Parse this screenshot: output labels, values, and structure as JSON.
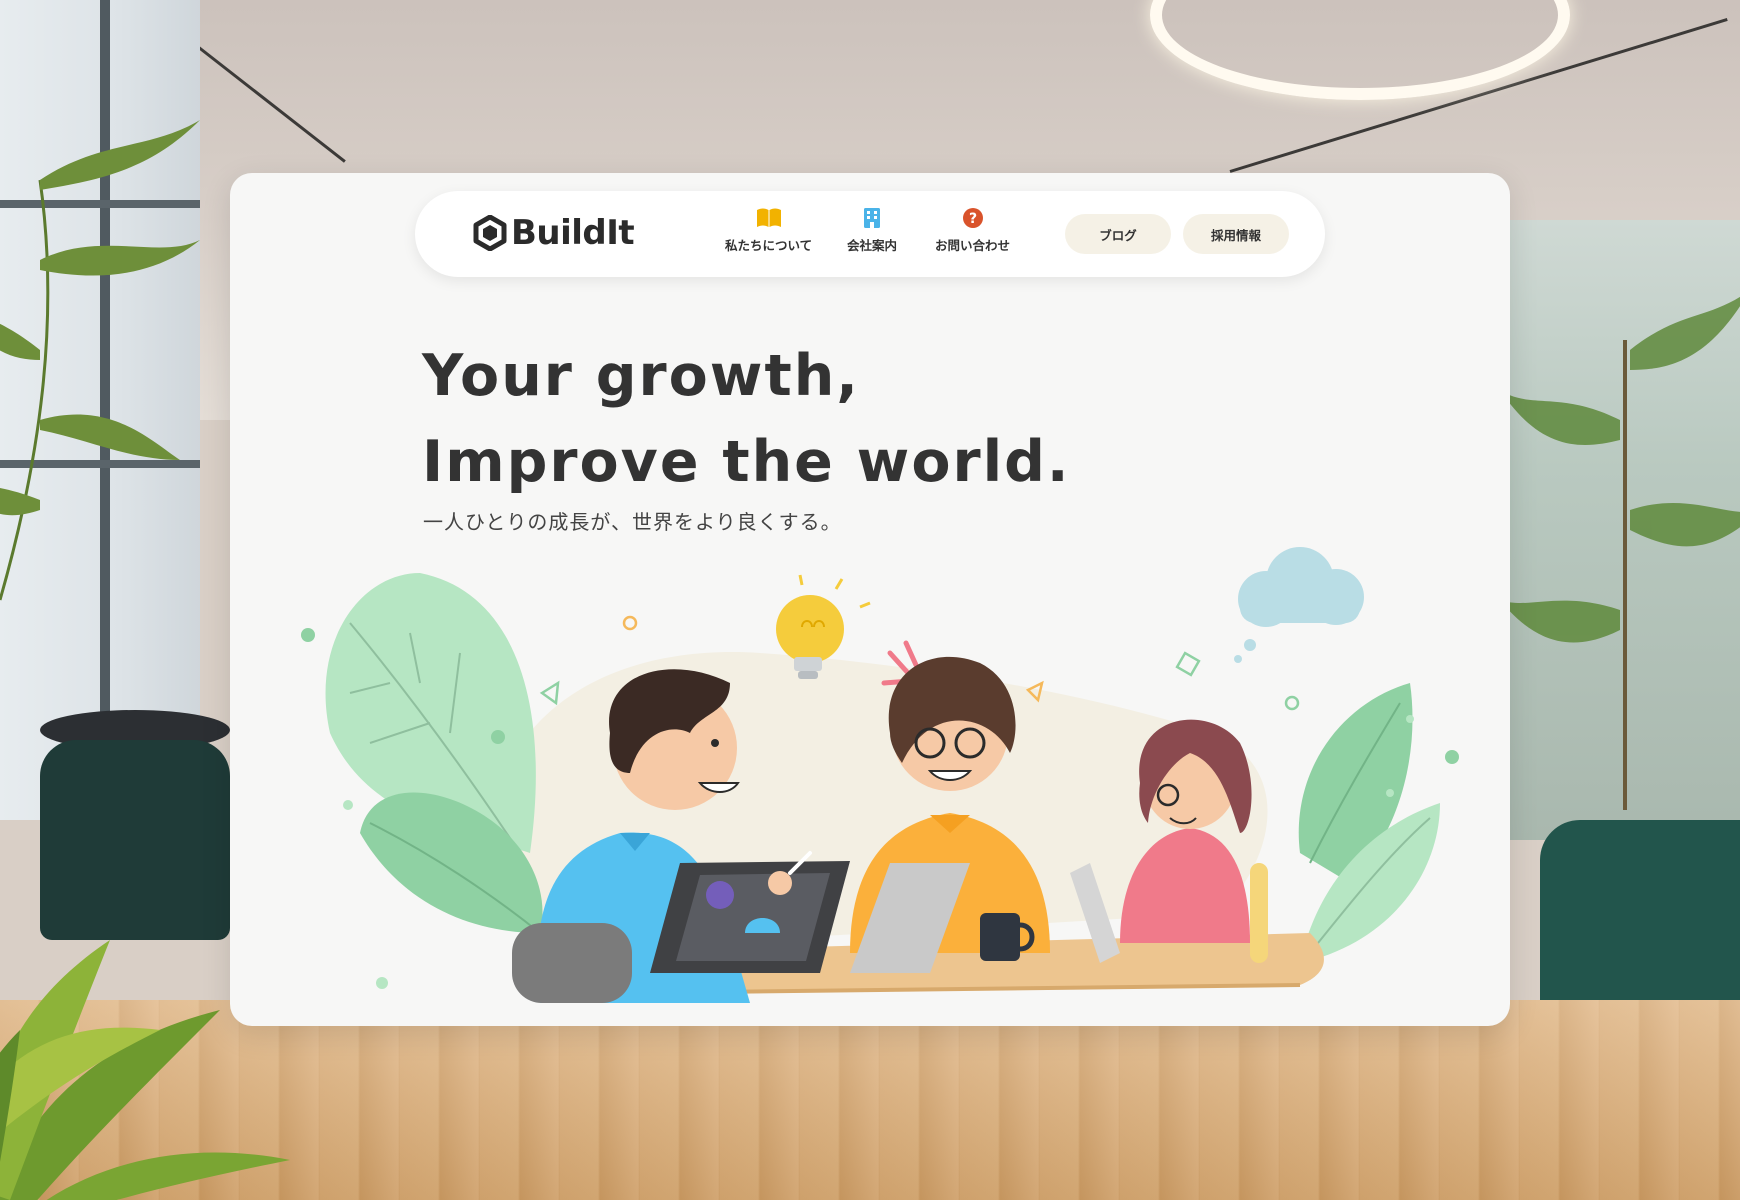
{
  "brand": {
    "name": "BuildIt"
  },
  "nav": {
    "items": [
      {
        "label": "私たちについて",
        "icon": "book-icon",
        "color": "#f2b200"
      },
      {
        "label": "会社案内",
        "icon": "building-icon",
        "color": "#4ab3e8"
      },
      {
        "label": "お問い合わせ",
        "icon": "question-icon",
        "color": "#d9532b"
      }
    ],
    "pills": [
      {
        "label": "ブログ"
      },
      {
        "label": "採用情報"
      }
    ]
  },
  "hero": {
    "title_line1": "Your growth,",
    "title_line2": "Improve the world.",
    "subtitle": "一人ひとりの成長が、世界をより良くする。"
  },
  "colors": {
    "card_bg": "#f7f7f6",
    "pill_bg": "#f5f1e6",
    "text": "#333333",
    "leaf_light": "#b6e6c3",
    "leaf_dark": "#8fd1a3"
  }
}
